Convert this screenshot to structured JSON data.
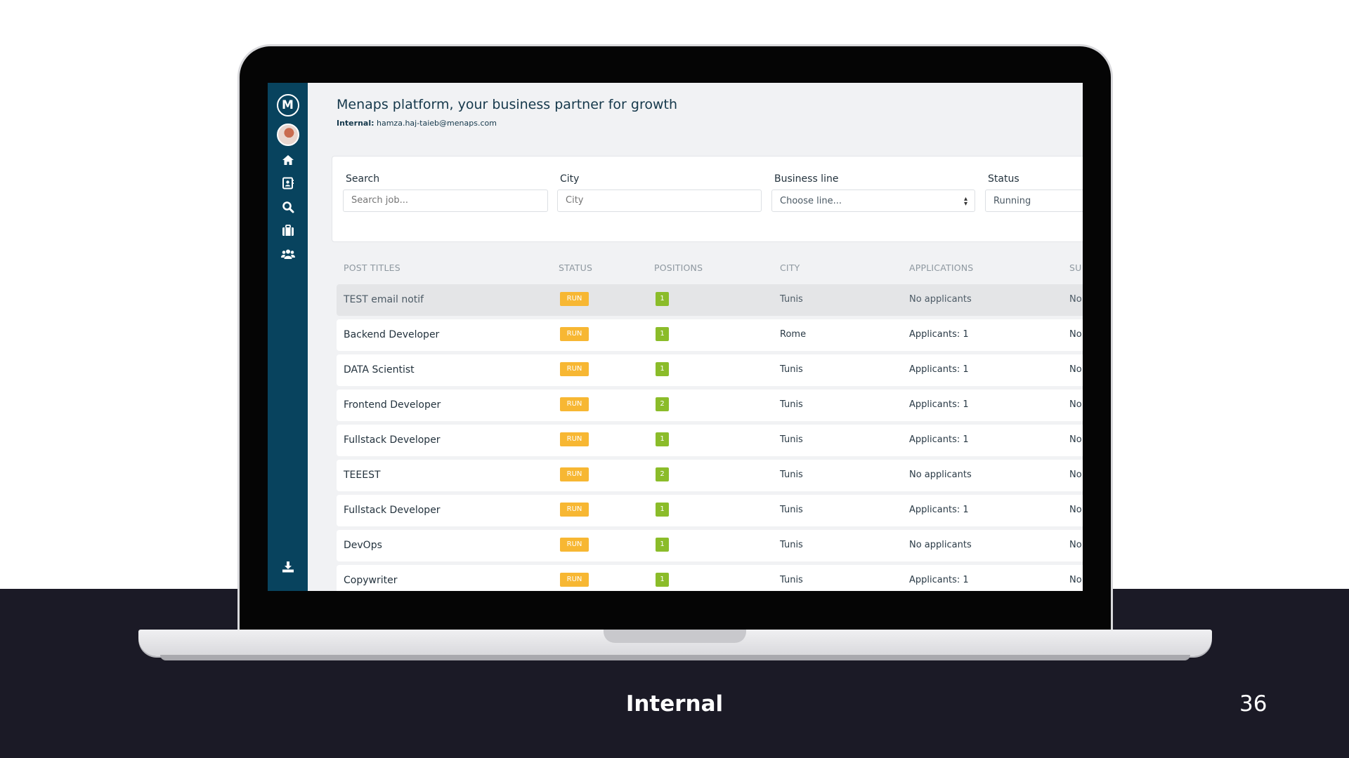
{
  "header": {
    "title": "Menaps platform, your business partner for growth",
    "sub_label": "Internal:",
    "sub_email": "hamza.haj-taieb@menaps.com"
  },
  "sidebar": {
    "logo_letter": "M",
    "icons": [
      "logo-icon",
      "avatar",
      "home-icon",
      "contact-card-icon",
      "search-icon",
      "briefcase-icon",
      "users-icon",
      "download-icon"
    ]
  },
  "filters": {
    "search": {
      "label": "Search",
      "placeholder": "Search job..."
    },
    "city": {
      "label": "City",
      "placeholder": "City"
    },
    "business_line": {
      "label": "Business line",
      "value": "Choose line..."
    },
    "status": {
      "label": "Status",
      "value": "Running"
    }
  },
  "table": {
    "columns": [
      "POST TITLES",
      "STATUS",
      "POSITIONS",
      "CITY",
      "APPLICATIONS",
      "SU"
    ],
    "rows": [
      {
        "title": "TEST email notif",
        "status": "RUN",
        "positions": "1",
        "city": "Tunis",
        "applications": "No applicants",
        "extra": "No"
      },
      {
        "title": "Backend Developer",
        "status": "RUN",
        "positions": "1",
        "city": "Rome",
        "applications": "Applicants: 1",
        "extra": "No"
      },
      {
        "title": "DATA Scientist",
        "status": "RUN",
        "positions": "1",
        "city": "Tunis",
        "applications": "Applicants: 1",
        "extra": "No"
      },
      {
        "title": "Frontend Developer",
        "status": "RUN",
        "positions": "2",
        "city": "Tunis",
        "applications": "Applicants: 1",
        "extra": "No"
      },
      {
        "title": "Fullstack Developer",
        "status": "RUN",
        "positions": "1",
        "city": "Tunis",
        "applications": "Applicants: 1",
        "extra": "No"
      },
      {
        "title": "TEEEST",
        "status": "RUN",
        "positions": "2",
        "city": "Tunis",
        "applications": "No applicants",
        "extra": "No"
      },
      {
        "title": "Fullstack Developer",
        "status": "RUN",
        "positions": "1",
        "city": "Tunis",
        "applications": "Applicants: 1",
        "extra": "No"
      },
      {
        "title": "DevOps",
        "status": "RUN",
        "positions": "1",
        "city": "Tunis",
        "applications": "No applicants",
        "extra": "No"
      },
      {
        "title": "Copywriter",
        "status": "RUN",
        "positions": "1",
        "city": "Tunis",
        "applications": "Applicants: 1",
        "extra": "No"
      }
    ]
  },
  "slide": {
    "footer_label": "Internal",
    "page_number": "36"
  },
  "colors": {
    "sidebar": "#08435e",
    "run_badge": "#f7b733",
    "positions_badge": "#8bbc2a",
    "slide_band": "#1b1a26"
  }
}
